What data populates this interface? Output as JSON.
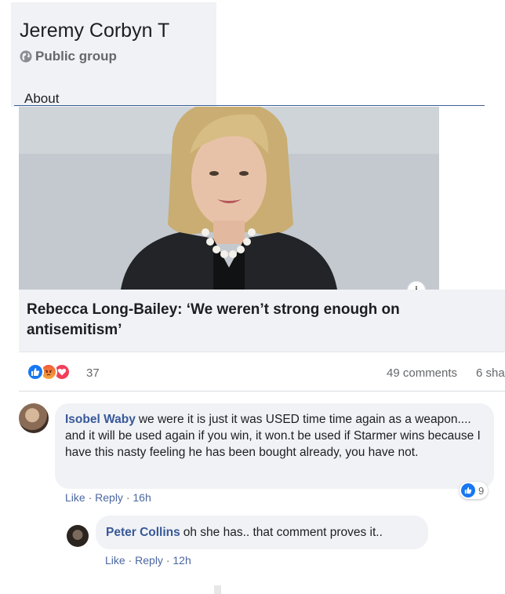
{
  "group": {
    "name": "Jeremy Corbyn T",
    "privacy": "Public group",
    "tab": "About"
  },
  "post": {
    "link_title": "Rebecca Long-Bailey: ‘We weren’t strong enough on antisemitism’",
    "info_glyph": "i",
    "reactions": {
      "icons": [
        "like-icon",
        "angry-icon",
        "love-icon"
      ],
      "count": "37"
    },
    "comments_label": "49 comments",
    "shares_label": "6 sha"
  },
  "comments": [
    {
      "author": "Isobel Waby",
      "text": "we were it is just it was USED time time again as a weapon.... and it will be used again if you win, it won.t be used if Starmer wins because I have this nasty feeling he has been bought already, you have not.",
      "like_label": "Like",
      "reply_label": "Reply",
      "time": "16h",
      "like_count": "9"
    },
    {
      "author": "Peter Collins",
      "text": "oh she has.. that comment proves it..",
      "like_label": "Like",
      "reply_label": "Reply",
      "time": "12h"
    }
  ],
  "colors": {
    "link": "#385898",
    "like_blue": "#1877f2",
    "bubble_bg": "#f0f2f5",
    "love_red": "#f33e58"
  }
}
